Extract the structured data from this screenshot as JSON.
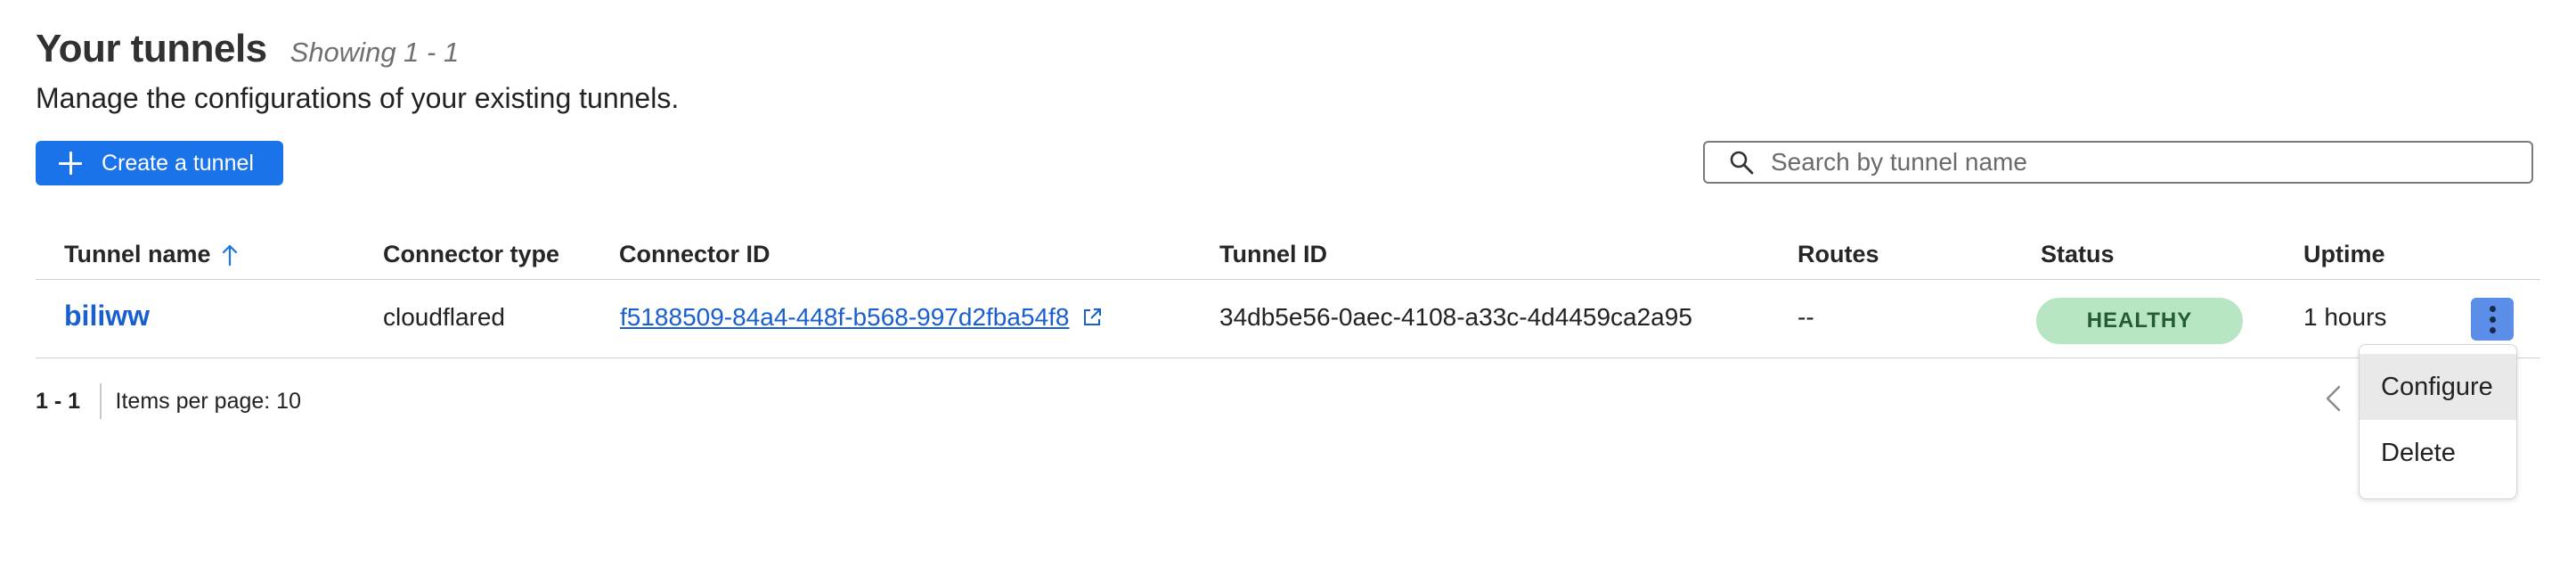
{
  "header": {
    "title": "Your tunnels",
    "showing": "Showing 1 - 1",
    "subtitle": "Manage the configurations of your existing tunnels."
  },
  "toolbar": {
    "create_label": "Create a tunnel",
    "search_placeholder": "Search by tunnel name",
    "search_value": ""
  },
  "table": {
    "columns": [
      "Tunnel name",
      "Connector type",
      "Connector ID",
      "Tunnel ID",
      "Routes",
      "Status",
      "Uptime"
    ],
    "sort": {
      "column": "Tunnel name",
      "direction": "ascending",
      "icon": "arrow-up-icon"
    },
    "rows": [
      {
        "tunnel_name": "biliww",
        "connector_type": "cloudflared",
        "connector_id": "f5188509-84a4-448f-b568-997d2fba54f8",
        "tunnel_id": "34db5e56-0aec-4108-a33c-4d4459ca2a95",
        "routes": "--",
        "status": "HEALTHY",
        "uptime": "1 hours"
      }
    ]
  },
  "pagination": {
    "range": "1 - 1",
    "items_per_page": "Items per page: 10"
  },
  "row_menu": {
    "items": [
      "Configure",
      "Delete"
    ],
    "highlighted": "Configure"
  },
  "colors": {
    "primary": "#1a73e8",
    "link": "#1a5fd0",
    "status_bg": "#b8e6c4",
    "status_text": "#245c35",
    "kebab_bg": "#5b8ee8"
  },
  "icons": [
    "plus-icon",
    "search-icon",
    "arrow-up-icon",
    "external-link-icon",
    "more-vertical-icon",
    "chevron-left-icon"
  ]
}
